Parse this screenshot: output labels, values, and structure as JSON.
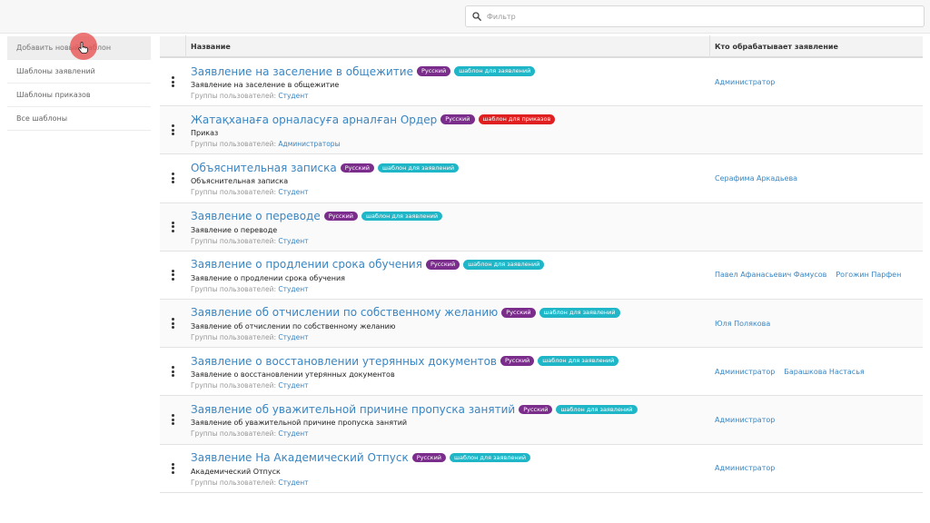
{
  "colors": {
    "link": "#3a86c3",
    "badge_lang": "#7b2d8b",
    "badge_app": "#1fb6c8",
    "badge_order": "#e02020"
  },
  "filter": {
    "placeholder": "Фильтр",
    "icon": "search-icon"
  },
  "sidebar": {
    "items": [
      {
        "label": "Добавить новый шаблон",
        "active": true
      },
      {
        "label": "Шаблоны заявлений",
        "active": false
      },
      {
        "label": "Шаблоны приказов",
        "active": false
      },
      {
        "label": "Все шаблоны",
        "active": false
      }
    ]
  },
  "table": {
    "headers": {
      "name": "Название",
      "who": "Кто обрабатывает заявление"
    },
    "groups_label": "Группы пользователей:",
    "rows": [
      {
        "title": "Заявление на заселение в общежитие",
        "lang": "Русский",
        "type": "шаблон для заявлений",
        "type_kind": "app",
        "desc": "Заявление на заселение в общежитие",
        "group": "Студент",
        "handlers": [
          "Администратор"
        ]
      },
      {
        "title": "Жатақханаға орналасуға арналған Ордер",
        "lang": "Русский",
        "type": "шаблон для приказов",
        "type_kind": "order",
        "desc": "Приказ",
        "group": "Администраторы",
        "handlers": []
      },
      {
        "title": "Объяснительная записка",
        "lang": "Русский",
        "type": "шаблон для заявлений",
        "type_kind": "app",
        "desc": "Объяснительная записка",
        "group": "Студент",
        "handlers": [
          "Серафима Аркадьева"
        ]
      },
      {
        "title": "Заявление о переводе",
        "lang": "Русский",
        "type": "шаблон для заявлений",
        "type_kind": "app",
        "desc": "Заявление о переводе",
        "group": "Студент",
        "handlers": []
      },
      {
        "title": "Заявление о продлении срока обучения",
        "lang": "Русский",
        "type": "шаблон для заявлений",
        "type_kind": "app",
        "desc": "Заявление о продлении срока обучения",
        "group": "Студент",
        "handlers": [
          "Павел Афанасьевич Фамусов",
          "Рогожин Парфен"
        ]
      },
      {
        "title": "Заявление об отчислении по собственному желанию",
        "lang": "Русский",
        "type": "шаблон для заявлений",
        "type_kind": "app",
        "desc": "Заявление об отчислении по собственному желанию",
        "group": "Студент",
        "handlers": [
          "Юля Полякова"
        ]
      },
      {
        "title": "Заявление о восстановлении утерянных документов",
        "lang": "Русский",
        "type": "шаблон для заявлений",
        "type_kind": "app",
        "desc": "Заявление о восстановлении утерянных документов",
        "group": "Студент",
        "handlers": [
          "Администратор",
          "Барашкова Настасья"
        ]
      },
      {
        "title": "Заявление об уважительной причине пропуска занятий",
        "lang": "Русский",
        "type": "шаблон для заявлений",
        "type_kind": "app",
        "desc": "Заявление об уважительной причине пропуска занятий",
        "group": "Студент",
        "handlers": [
          "Администратор"
        ]
      },
      {
        "title": "Заявление На Академический Отпуск",
        "lang": "Русский",
        "type": "шаблон для заявлений",
        "type_kind": "app",
        "desc": "Академический Отпуск",
        "group": "Студент",
        "handlers": [
          "Администратор"
        ]
      }
    ]
  }
}
